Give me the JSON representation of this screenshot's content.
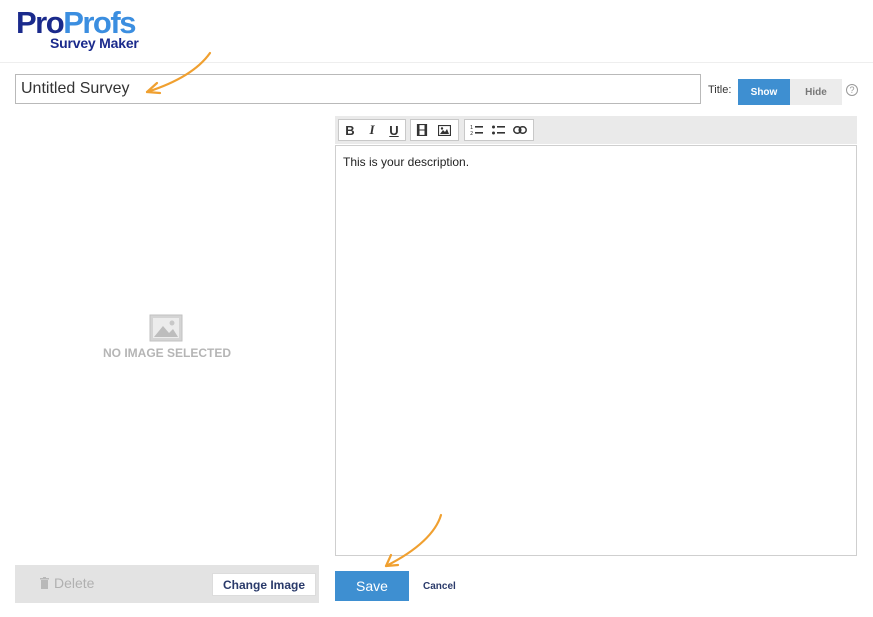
{
  "logo": {
    "main_a": "Pro",
    "main_b": "Profs",
    "sub": "Survey Maker"
  },
  "survey": {
    "title_value": "Untitled Survey"
  },
  "title_toggle": {
    "label": "Title:",
    "show": "Show",
    "hide": "Hide",
    "help": "?"
  },
  "image_panel": {
    "no_image": "NO IMAGE SELECTED",
    "delete": "Delete",
    "change_image": "Change Image"
  },
  "toolbar": {
    "bold": "B",
    "italic": "I",
    "underline": "U"
  },
  "editor": {
    "description": "This is your description."
  },
  "actions": {
    "save": "Save",
    "cancel": "Cancel"
  },
  "colors": {
    "accent": "#3e8fd1",
    "brand_dark": "#1a2a8c",
    "brand_light": "#3b8ee0",
    "annotation_arrow": "#f0a030"
  },
  "icons": [
    "bold-icon",
    "italic-icon",
    "underline-icon",
    "video-icon",
    "image-icon",
    "ordered-list-icon",
    "unordered-list-icon",
    "link-icon",
    "trash-icon",
    "no-image-icon",
    "help-icon"
  ]
}
